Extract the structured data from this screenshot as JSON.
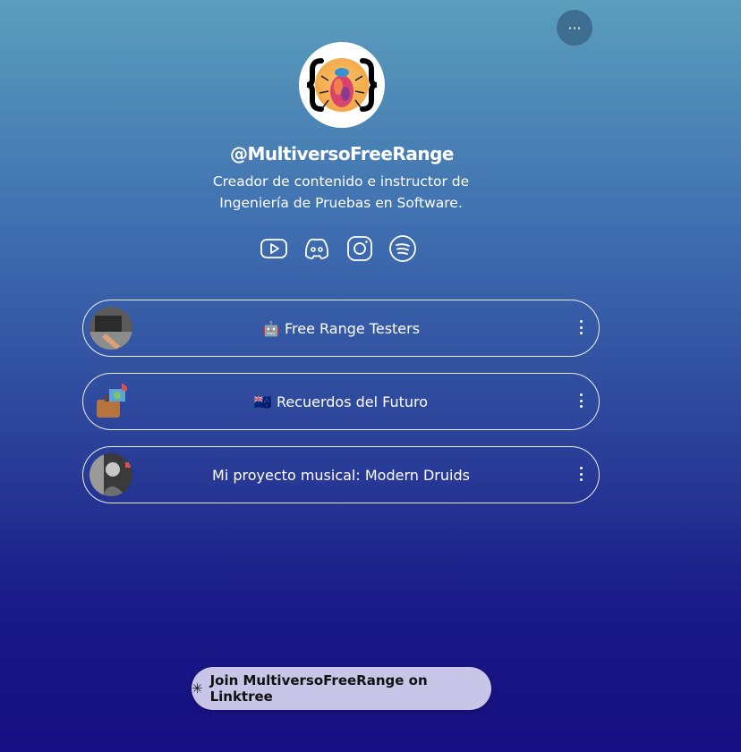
{
  "header": {
    "more_label": "···"
  },
  "profile": {
    "handle": "@MultiversoFreeRange",
    "bio_line1": "Creador de contenido e instructor de",
    "bio_line2": "Ingeniería de Pruebas en Software."
  },
  "socials": [
    {
      "icon": "youtube-icon"
    },
    {
      "icon": "discord-icon"
    },
    {
      "icon": "instagram-icon"
    },
    {
      "icon": "spotify-icon"
    }
  ],
  "links": [
    {
      "emoji": "🤖",
      "text": "Free Range Testers"
    },
    {
      "emoji": "🇳🇿",
      "text": "Recuerdos del Futuro"
    },
    {
      "emoji": "",
      "text": "Mi proyecto musical: Modern Druids"
    }
  ],
  "footer": {
    "join_icon": "✳",
    "join_label": "Join MultiversoFreeRange on Linktree"
  },
  "colors": {
    "bg_top": "#5a9ebc",
    "bg_bottom": "#160f83",
    "join_bg": "#c9c5e8"
  }
}
